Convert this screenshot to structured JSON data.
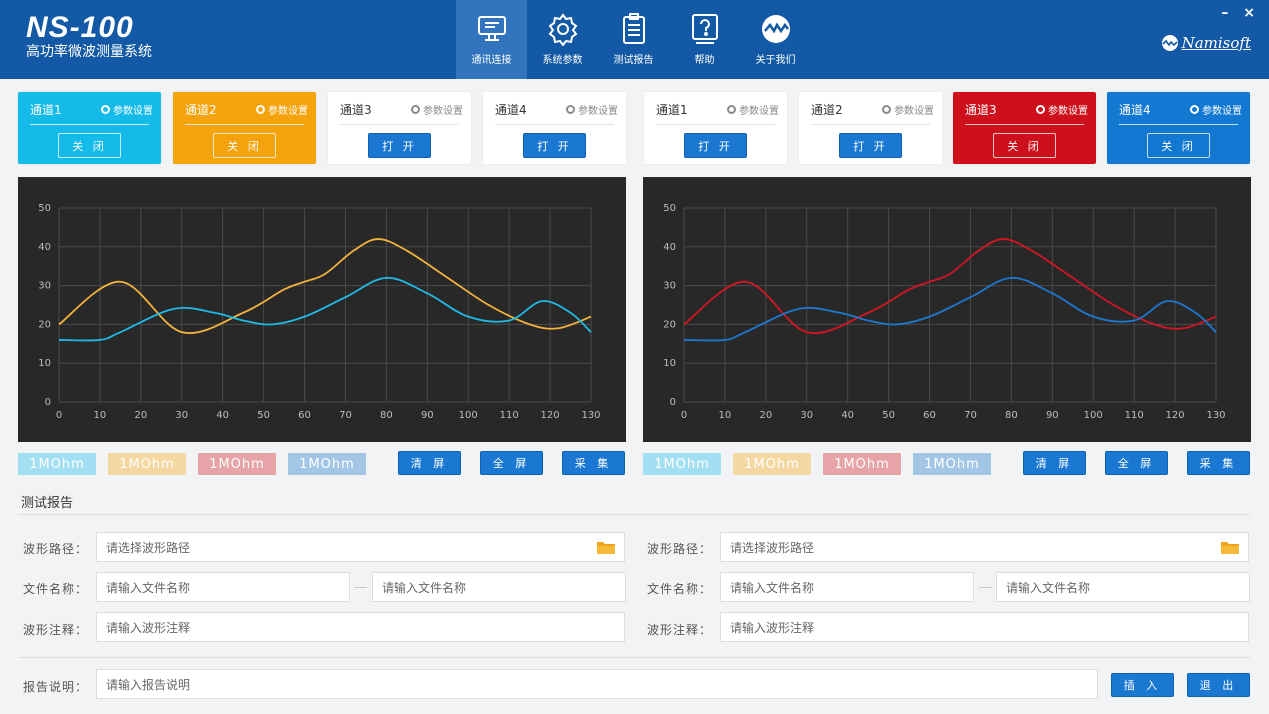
{
  "header": {
    "title": "NS-100",
    "subtitle": "高功率微波测量系统",
    "brand": "Namisoft",
    "minimize": "–",
    "close": "×",
    "nav": [
      {
        "label": "通讯连接",
        "icon": "monitor-icon"
      },
      {
        "label": "系统参数",
        "icon": "gear-icon"
      },
      {
        "label": "测试报告",
        "icon": "clipboard-icon"
      },
      {
        "label": "帮助",
        "icon": "help-icon"
      },
      {
        "label": "关于我们",
        "icon": "pulse-logo-icon"
      }
    ]
  },
  "channels": [
    {
      "name": "通道1",
      "settings": "参数设置",
      "button": "关 闭",
      "state": "open",
      "color": "#14bbe8"
    },
    {
      "name": "通道2",
      "settings": "参数设置",
      "button": "关 闭",
      "state": "open",
      "color": "#f4a30c"
    },
    {
      "name": "通道3",
      "settings": "参数设置",
      "button": "打 开",
      "state": "closed",
      "color": "#ffffff"
    },
    {
      "name": "通道4",
      "settings": "参数设置",
      "button": "打 开",
      "state": "closed",
      "color": "#ffffff"
    },
    {
      "name": "通道1",
      "settings": "参数设置",
      "button": "打 开",
      "state": "closed",
      "color": "#ffffff"
    },
    {
      "name": "通道2",
      "settings": "参数设置",
      "button": "打 开",
      "state": "closed",
      "color": "#ffffff"
    },
    {
      "name": "通道3",
      "settings": "参数设置",
      "button": "关 闭",
      "state": "open",
      "color": "#cd101b"
    },
    {
      "name": "通道4",
      "settings": "参数设置",
      "button": "关 闭",
      "state": "open",
      "color": "#1278d2"
    }
  ],
  "chart_data": [
    {
      "type": "line",
      "xlim": [
        0,
        130
      ],
      "ylim": [
        0,
        50
      ],
      "xticks": [
        "0",
        "10",
        "20",
        "30",
        "40",
        "50",
        "60",
        "70",
        "80",
        "90",
        "100",
        "110",
        "120",
        "130"
      ],
      "yticks": [
        "0",
        "10",
        "20",
        "30",
        "40",
        "50"
      ],
      "grid": true,
      "series": [
        {
          "color": "#f2b33d",
          "x": [
            0,
            15,
            30,
            45,
            55,
            60,
            65,
            72,
            78,
            85,
            95,
            105,
            115,
            122,
            130
          ],
          "y": [
            20,
            31,
            18,
            23,
            29,
            31,
            33,
            39,
            42,
            39,
            32,
            25,
            20,
            19,
            22
          ]
        },
        {
          "color": "#1fb9e6",
          "x": [
            0,
            10,
            15,
            28,
            38,
            45,
            52,
            60,
            70,
            80,
            90,
            100,
            110,
            118,
            125,
            130
          ],
          "y": [
            16,
            16,
            18,
            24,
            23,
            21,
            20,
            22,
            27,
            32,
            28,
            22,
            21,
            26,
            23,
            18
          ]
        }
      ]
    },
    {
      "type": "line",
      "xlim": [
        0,
        130
      ],
      "ylim": [
        0,
        50
      ],
      "xticks": [
        "0",
        "10",
        "20",
        "30",
        "40",
        "50",
        "60",
        "70",
        "80",
        "90",
        "100",
        "110",
        "120",
        "130"
      ],
      "yticks": [
        "0",
        "10",
        "20",
        "30",
        "40",
        "50"
      ],
      "grid": true,
      "series": [
        {
          "color": "#d41622",
          "x": [
            0,
            15,
            30,
            45,
            55,
            60,
            65,
            72,
            78,
            85,
            95,
            105,
            115,
            122,
            130
          ],
          "y": [
            20,
            31,
            18,
            23,
            29,
            31,
            33,
            39,
            42,
            39,
            32,
            25,
            20,
            19,
            22
          ]
        },
        {
          "color": "#1d78cf",
          "x": [
            0,
            10,
            15,
            28,
            38,
            45,
            52,
            60,
            70,
            80,
            90,
            100,
            110,
            118,
            125,
            130
          ],
          "y": [
            16,
            16,
            18,
            24,
            23,
            21,
            20,
            22,
            27,
            32,
            28,
            22,
            21,
            26,
            23,
            18
          ]
        }
      ]
    }
  ],
  "left_panel": {
    "tags": [
      {
        "label": "1MOhm",
        "color": "#a3dff2"
      },
      {
        "label": "1MOhm",
        "color": "#f5d8a1"
      },
      {
        "label": "1MOhm",
        "color": "#e6a3a8"
      },
      {
        "label": "1MOhm",
        "color": "#a3c6e7"
      }
    ],
    "buttons": [
      "清 屏",
      "全 屏",
      "采 集"
    ]
  },
  "right_panel": {
    "tags": [
      {
        "label": "1MOhm",
        "color": "#a3dff2"
      },
      {
        "label": "1MOhm",
        "color": "#f5d8a1"
      },
      {
        "label": "1MOhm",
        "color": "#e6a3a8"
      },
      {
        "label": "1MOhm",
        "color": "#a3c6e7"
      }
    ],
    "buttons": [
      "清 屏",
      "全 屏",
      "采 集"
    ]
  },
  "report": {
    "title": "测试报告",
    "left": {
      "path_label": "波形路径：",
      "path_placeholder": "请选择波形路径",
      "file_label": "文件名称：",
      "file1_placeholder": "请输入文件名称",
      "file2_placeholder": "请输入文件名称",
      "note_label": "波形注释：",
      "note_placeholder": "请输入波形注释"
    },
    "right": {
      "path_label": "波形路径：",
      "path_placeholder": "请选择波形路径",
      "file_label": "文件名称：",
      "file1_placeholder": "请输入文件名称",
      "file2_placeholder": "请输入文件名称",
      "note_label": "波形注释：",
      "note_placeholder": "请输入波形注释"
    },
    "desc_label": "报告说明：",
    "desc_placeholder": "请输入报告说明",
    "insert_button": "插 入",
    "exit_button": "退 出"
  }
}
